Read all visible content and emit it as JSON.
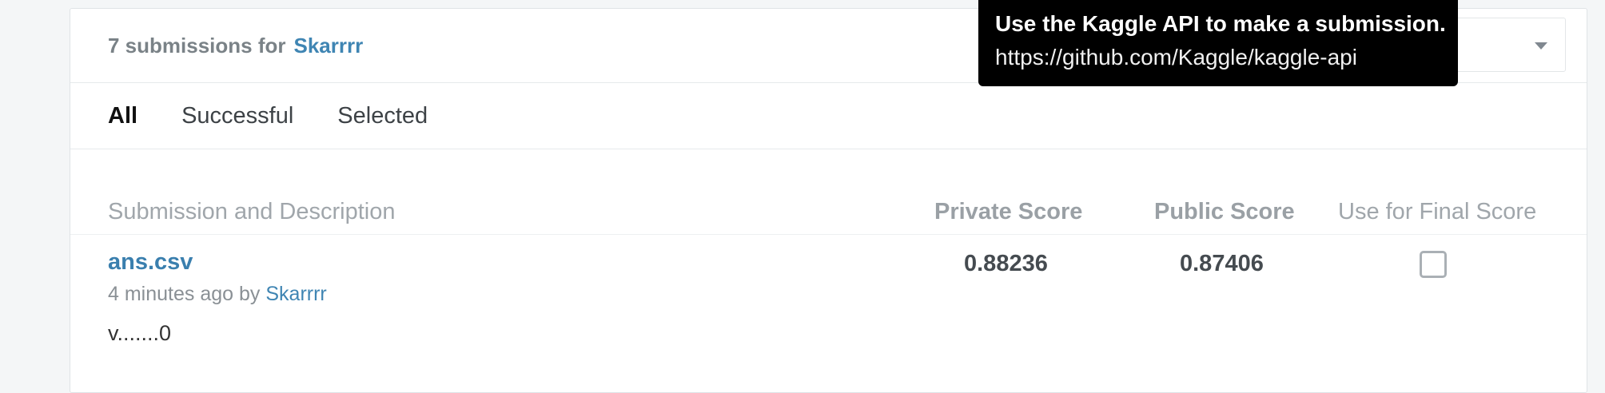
{
  "header": {
    "count_text": "7 submissions for",
    "user": "Skarrrr"
  },
  "tabs": [
    {
      "label": "All",
      "active": true
    },
    {
      "label": "Successful",
      "active": false
    },
    {
      "label": "Selected",
      "active": false
    }
  ],
  "table": {
    "columns": {
      "description": "Submission and Description",
      "private_score": "Private Score",
      "public_score": "Public Score",
      "final_score": "Use for Final Score"
    },
    "rows": [
      {
        "filename": "ans.csv",
        "time": "4 minutes ago by",
        "user": "Skarrrr",
        "description": "v.......0",
        "private_score": "0.88236",
        "public_score": "0.87406",
        "selected": false
      }
    ]
  },
  "tooltip": {
    "line1": "Use the Kaggle API to make a submission.",
    "line2": "https://github.com/Kaggle/kaggle-api"
  },
  "colors": {
    "link": "#3f85b3",
    "tooltip_bg": "#000000"
  }
}
